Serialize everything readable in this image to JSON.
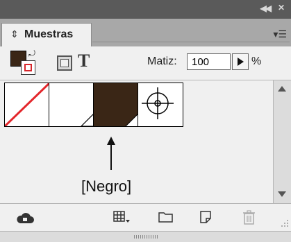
{
  "panel": {
    "collapse_icon": "double-chevron-left-icon",
    "close_icon": "close-icon",
    "tab_label": "Muestras",
    "tab_icon": "sort-arrows-icon",
    "menu_icon": "panel-menu-icon"
  },
  "controls": {
    "fill_color": "#3a2616",
    "stroke_color": "#d6262b",
    "text_button_label": "T",
    "tint_label": "Matiz:",
    "tint_value": "100",
    "tint_unit": "%"
  },
  "swatches": [
    {
      "name": "none-swatch",
      "type": "none"
    },
    {
      "name": "paper-swatch",
      "type": "paper",
      "color": "#ffffff"
    },
    {
      "name": "black-swatch",
      "type": "black",
      "color": "#3a2616"
    },
    {
      "name": "registration-swatch",
      "type": "registration"
    }
  ],
  "annotation": {
    "label": "[Negro]"
  },
  "bottom_toolbar": {
    "icons": [
      "cloud-icon",
      "grid-view-icon",
      "folder-icon",
      "new-swatch-icon",
      "trash-icon"
    ]
  }
}
